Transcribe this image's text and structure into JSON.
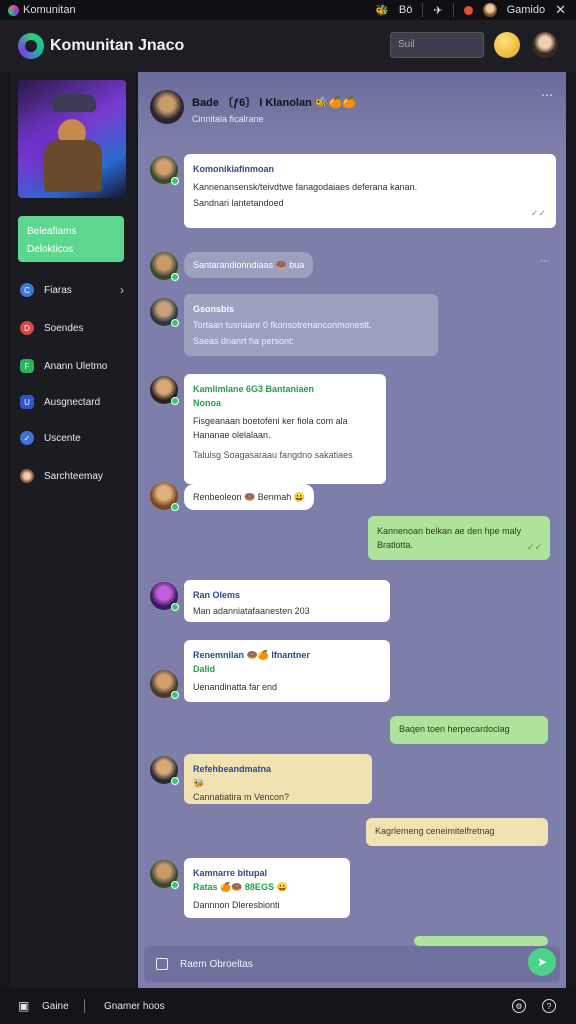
{
  "titlebar": {
    "app_name": "Komunitan",
    "item_1": "Bö",
    "item_2": "Gamido"
  },
  "header": {
    "brand": "Komunitan Jnaco",
    "search_placeholder": "Suil"
  },
  "sidebar": {
    "cta_line1": "Beleafiams",
    "cta_line2": "Delokticos",
    "nav": [
      {
        "label": "Fiaras",
        "icon": "circle-c-icon",
        "color": "#3c7ad6"
      },
      {
        "label": "Soendes",
        "icon": "circle-d-icon",
        "color": "#d44848"
      },
      {
        "label": "Anann Uletmo",
        "icon": "square-f-icon",
        "color": "#2bb35a"
      },
      {
        "label": "Ausgnectard",
        "icon": "circle-u-icon",
        "color": "#2f56c9"
      },
      {
        "label": "Uscente",
        "icon": "circle-badge-icon",
        "color": "#3d73d6"
      },
      {
        "label": "Sarchteemay",
        "icon": "avatar-icon",
        "color": "#8a5a3a"
      }
    ]
  },
  "chat": {
    "title": "Bade 〔ƒ6〕 l Klanolan 🐝🍊🍊",
    "subtitle": "Cinnitala ficalrane",
    "messages": [
      {
        "name": "Komonikiafinmoan",
        "text": "Kannenansensk/teivdtwe fanagodaiaes deferana kanan.",
        "meta": "Sandnari lantetandoed"
      },
      {
        "pill": "Santarandionndiaas 🍩 bua"
      },
      {
        "name": "Gsonsbis",
        "text": "Tortaan tusnaanr 0 fkonsotrenanconmonestt.",
        "meta": "Saeas drianrt ha persont:"
      },
      {
        "name": "Kamlimlane 6G3 Bantaniaen",
        "name2": "Nonoa",
        "text": "Fisgeanaan boetofeni ker fiola com ala Hananae olelalaan.",
        "meta": "Taluisg Soagasaraau fangdno sakatiaes"
      },
      {
        "pill": "Renbeoleon 🍩 Benmah 😀"
      },
      {
        "text": "Kannenoan belkan ae den hpe maly Bratlotta."
      },
      {
        "name": "Ran Olems",
        "text": "Man adanniatafaanesten 203"
      },
      {
        "name": "Renemnilan 🍩🍊 Ifnantner",
        "name2": "Dalid",
        "text": "Uenandinatta far end"
      },
      {
        "text": "Baqen toen herpecardoclag"
      },
      {
        "name": "Refehbeandmatna",
        "name2": "🐝",
        "text": "Cannatiatira m Vencon?"
      },
      {
        "text": "Kagrlemeng ceneimitelfretnag"
      },
      {
        "name": "Kamnarre bitupal",
        "name2": "Ratas 🍊🍩 88EGS 😀",
        "text": "Dannnon Dleresbionti"
      }
    ],
    "composer_placeholder": "Raem Obroeltas"
  },
  "footer": {
    "left": "Gaine",
    "middle": "Gnamer hoos"
  }
}
